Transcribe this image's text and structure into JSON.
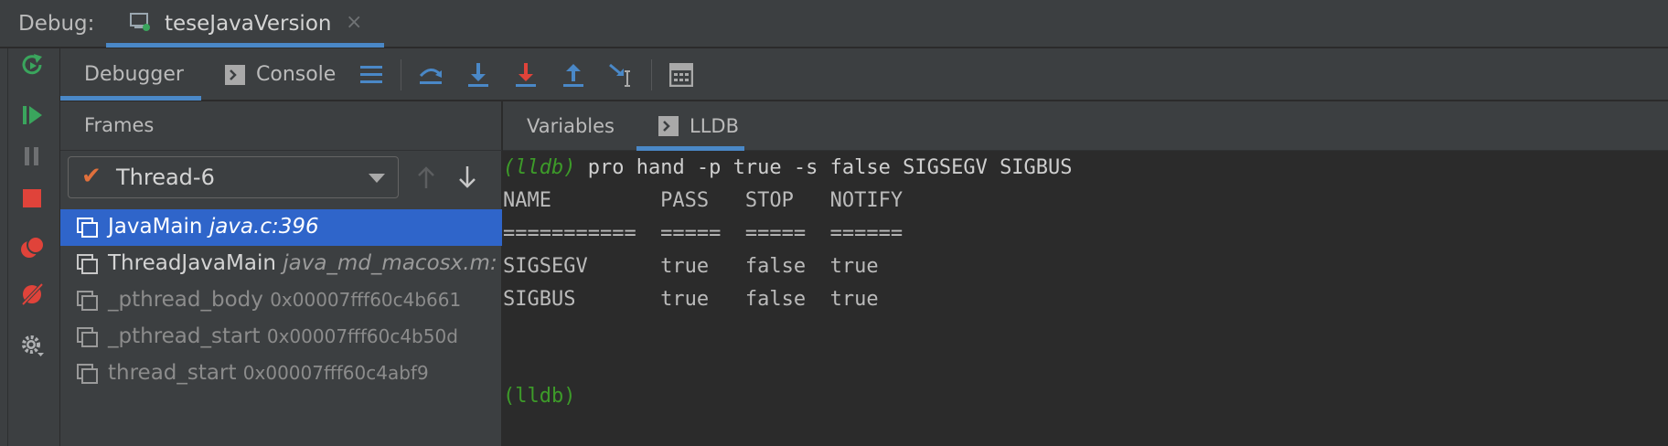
{
  "topbar": {
    "label": "Debug:",
    "session_name": "teseJavaVersion",
    "close_glyph": "×"
  },
  "toolbar": {
    "tabs": [
      {
        "label": "Debugger",
        "active": true
      },
      {
        "label": "Console",
        "active": false
      }
    ],
    "icons": [
      "layout-menu-icon",
      "step-over-icon",
      "step-into-icon",
      "force-step-into-icon",
      "step-out-icon",
      "run-to-cursor-icon",
      "evaluate-expression-icon"
    ]
  },
  "left_strip": {
    "icons": [
      "rerun-icon",
      "resume-icon",
      "pause-icon",
      "stop-icon",
      "view-breakpoints-icon",
      "mute-breakpoints-icon",
      "settings-icon"
    ]
  },
  "frames": {
    "title": "Frames",
    "thread": "Thread-6",
    "items": [
      {
        "name": "JavaMain",
        "location": "java.c:396",
        "address": ""
      },
      {
        "name": "ThreadJavaMain",
        "location": "java_md_macosx.m:",
        "address": ""
      },
      {
        "name": "_pthread_body",
        "location": "",
        "address": "0x00007fff60c4b661"
      },
      {
        "name": "_pthread_start",
        "location": "",
        "address": "0x00007fff60c4b50d"
      },
      {
        "name": "thread_start",
        "location": "",
        "address": "0x00007fff60c4abf9"
      }
    ]
  },
  "right_tabs": [
    {
      "label": "Variables"
    },
    {
      "label": "LLDB"
    }
  ],
  "console": {
    "prompt": "(lldb)",
    "command": " pro hand -p true -s false SIGSEGV SIGBUS",
    "header": "NAME         PASS   STOP   NOTIFY",
    "separator": "===========  =====  =====  ======",
    "rows": [
      "SIGSEGV      true   false  true",
      "SIGBUS       true   false  true"
    ],
    "prompt_end": "(lldb)"
  },
  "colors": {
    "accent": "#4a88c7",
    "selection": "#2f65ca",
    "prompt": "#3d9b29",
    "stop": "#e0433a",
    "resume": "#3aa55d"
  }
}
